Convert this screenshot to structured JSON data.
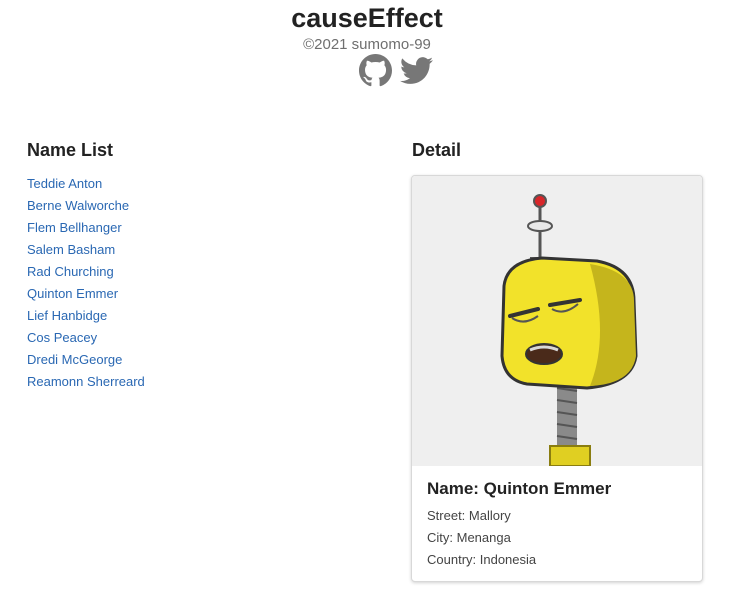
{
  "header": {
    "title": "causeEffect",
    "copyright": "©2021 sumomo-99",
    "social": [
      {
        "icon": "github-icon"
      },
      {
        "icon": "twitter-icon"
      }
    ]
  },
  "name_list": {
    "title": "Name List",
    "items": [
      "Teddie Anton",
      "Berne Walworche",
      "Flem Bellhanger",
      "Salem Basham",
      "Rad Churching",
      "Quinton Emmer",
      "Lief Hanbidge",
      "Cos Peacey",
      "Dredi McGeorge",
      "Reamonn Sherreard"
    ]
  },
  "detail": {
    "title": "Detail",
    "name": "Name: Quinton Emmer",
    "street": "Street: Mallory",
    "city": "City: Menanga",
    "country": "Country: Indonesia",
    "avatar_icon": "robot-avatar"
  },
  "colors": {
    "link": "#2a68b3",
    "icon_gray": "#777777",
    "robot_yellow": "#f2e22a"
  }
}
